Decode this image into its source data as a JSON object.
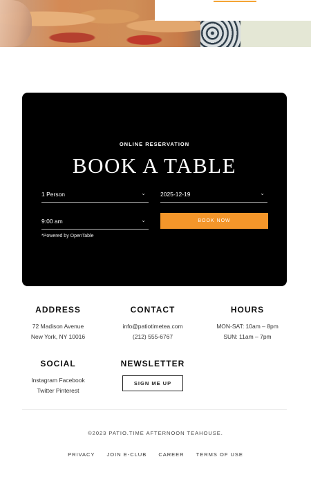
{
  "reservation": {
    "eyebrow": "ONLINE RESERVATION",
    "title": "BOOK A TABLE",
    "party_size": "1 Person",
    "date": "2025-12-19",
    "time": "9:00 am",
    "book_label": "BOOK NOW",
    "powered": "*Powered by OpenTable",
    "chevron_icon": "chevron-down-icon"
  },
  "address": {
    "heading": "ADDRESS",
    "line1": "72 Madison Avenue",
    "line2": "New York, NY 10016"
  },
  "contact": {
    "heading": "CONTACT",
    "email": "info@patiotimetea.com",
    "phone": "(212) 555-6767"
  },
  "hours": {
    "heading": "HOURS",
    "line1": "MON-SAT: 10am – 8pm",
    "line2": "SUN: 11am – 7pm"
  },
  "social": {
    "heading": "SOCIAL",
    "line1": "Instagram Facebook",
    "line2": "Twitter Pinterest"
  },
  "newsletter": {
    "heading": "NEWSLETTER",
    "button": "SIGN ME UP"
  },
  "footer": {
    "copyright": "©2023 PATIO.TIME AFTERNOON TEAHOUSE.",
    "links": [
      "PRIVACY",
      "JOIN E-CLUB",
      "CAREER",
      "TERMS OF USE"
    ]
  },
  "colors": {
    "accent": "#f4962a",
    "dark": "#000000",
    "sage": "#e4e7d5"
  }
}
